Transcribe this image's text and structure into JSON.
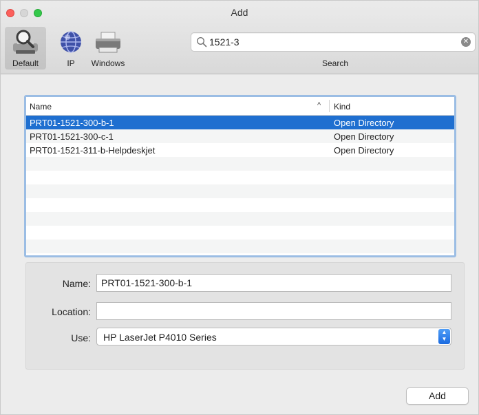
{
  "window": {
    "title": "Add"
  },
  "toolbar": {
    "tools": [
      {
        "label": "Default",
        "icon": "default-printer-search-icon",
        "selected": true
      },
      {
        "label": "IP",
        "icon": "globe-icon"
      },
      {
        "label": "Windows",
        "icon": "windows-printer-icon"
      }
    ],
    "search": {
      "value": "1521-3",
      "label": "Search"
    }
  },
  "list": {
    "columns": {
      "name": "Name",
      "kind": "Kind"
    },
    "rows": [
      {
        "name": "PRT01-1521-300-b-1",
        "kind": "Open Directory",
        "selected": true
      },
      {
        "name": "PRT01-1521-300-c-1",
        "kind": "Open Directory"
      },
      {
        "name": "PRT01-1521-311-b-Helpdeskjet",
        "kind": "Open Directory"
      }
    ]
  },
  "details": {
    "name_label": "Name:",
    "name_value": "PRT01-1521-300-b-1",
    "location_label": "Location:",
    "location_value": "",
    "use_label": "Use:",
    "use_value": "HP LaserJet P4010 Series"
  },
  "buttons": {
    "add": "Add"
  },
  "colors": {
    "selection": "#1f6fd0",
    "focus_ring": "#9bbde4"
  }
}
